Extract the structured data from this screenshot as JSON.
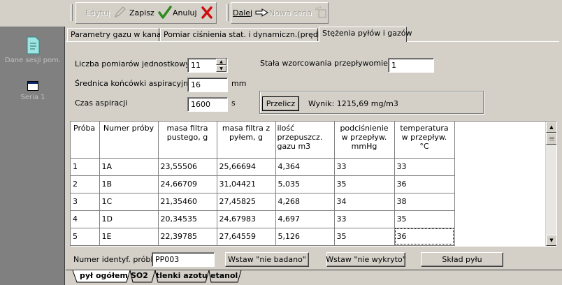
{
  "toolbar": {
    "edit_label": "Edytuj",
    "save_label": "Zapisz",
    "cancel_label": "Anuluj",
    "next_label": "Dalej",
    "new_series_label": "Nowa seria"
  },
  "sidebar": {
    "items": [
      {
        "label": "Dane sesji pom.",
        "icon": "document-icon"
      },
      {
        "label": "Seria 1",
        "icon": "window-icon"
      }
    ]
  },
  "tabs": [
    {
      "label": "Parametry gazu w kanale"
    },
    {
      "label": "Pomiar ciśnienia stat. i dynamiczn.(prędkości)"
    },
    {
      "label": "Stężenia pyłów i gazów"
    }
  ],
  "form": {
    "measurements_label": "Liczba pomiarów jednostkowych",
    "measurements_value": "11",
    "calibration_label": "Stała wzorcowania przepływomierza",
    "calibration_value": "1",
    "tip_diameter_label": "Średnica końcówki aspiracyjnej",
    "tip_diameter_value": "16",
    "tip_diameter_unit": "mm",
    "aspiration_label": "Czas aspiracji",
    "aspiration_value": "1600",
    "aspiration_unit": "s",
    "calc_button": "Przelicz",
    "result_text": "Wynik: 1215,69 mg/m3"
  },
  "grid": {
    "columns": [
      "Próba",
      "Numer próby",
      "masa filtra pustego, g",
      "masa filtra z pyłem, g",
      "ilość przepuszcz. gazu m3",
      "podciśnienie w przepływ. mmHg",
      "temperatura w przepływ. °C"
    ],
    "rows": [
      [
        "1",
        "1A",
        "23,55506",
        "25,66694",
        "4,364",
        "33",
        "33"
      ],
      [
        "2",
        "1B",
        "24,66709",
        "31,04421",
        "5,035",
        "35",
        "36"
      ],
      [
        "3",
        "1C",
        "21,35460",
        "27,45825",
        "4,268",
        "34",
        "38"
      ],
      [
        "4",
        "1D",
        "20,34535",
        "24,67983",
        "4,697",
        "33",
        "35"
      ],
      [
        "5",
        "1E",
        "22,39785",
        "27,64559",
        "5,126",
        "35",
        "36"
      ]
    ]
  },
  "bottom": {
    "sample_id_label": "Numer identyf. próbki",
    "sample_id_value": "PP003",
    "not_tested_button": "Wstaw \"nie badano\"",
    "not_detected_button": "Wstaw \"nie wykryto\"",
    "dust_composition_button": "Skład pyłu"
  },
  "bottom_tabs": [
    {
      "label": "pył ogółem"
    },
    {
      "label": "SO2"
    },
    {
      "label": "tlenki azotu"
    },
    {
      "label": "etanol"
    }
  ],
  "colors": {
    "window_bg": "#d4d0c8",
    "sidebar_bg": "#808080",
    "save_check": "#2e8b20",
    "cancel_x": "#cc1010"
  }
}
